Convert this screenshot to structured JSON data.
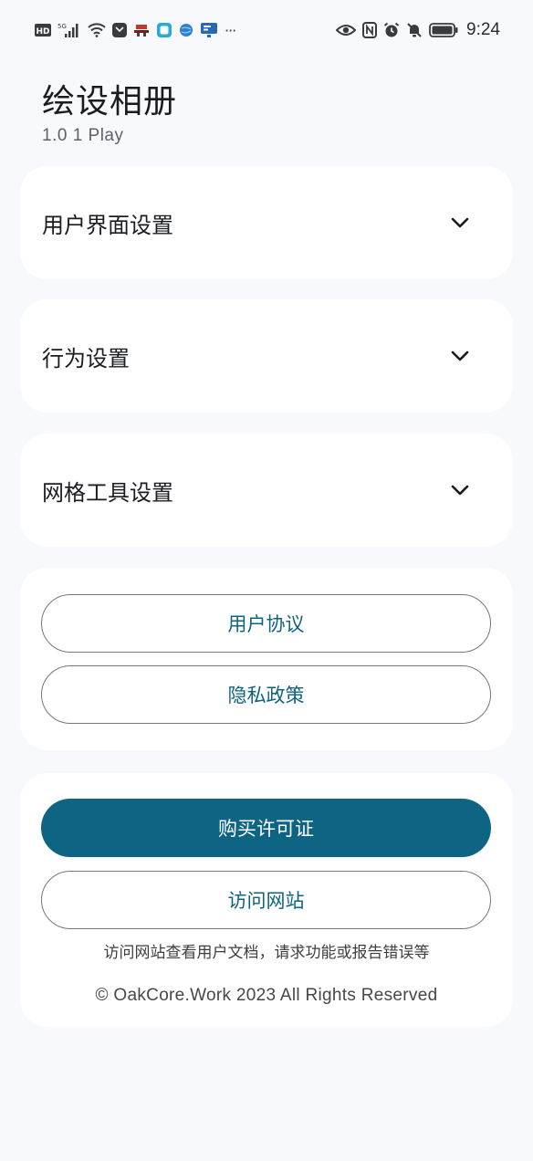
{
  "status_bar": {
    "left_icons": [
      "hd-icon",
      "signal-5g-icon",
      "wifi-icon",
      "app-shield-icon",
      "app-red-icon",
      "app-square-icon",
      "app-globe-icon",
      "app-monitor-icon"
    ],
    "more": "···",
    "right_icons": [
      "eye-icon",
      "nfc-icon",
      "alarm-icon",
      "mute-icon",
      "battery-icon"
    ],
    "time": "9:24"
  },
  "header": {
    "title": "绘设相册",
    "version": "1.0 1 Play"
  },
  "sections": [
    {
      "title": "用户界面设置"
    },
    {
      "title": "行为设置"
    },
    {
      "title": "网格工具设置"
    }
  ],
  "legal": {
    "user_agreement": "用户协议",
    "privacy_policy": "隐私政策"
  },
  "purchase": {
    "buy_license": "购买许可证",
    "visit_site": "访问网站",
    "hint": "访问网站查看用户文档，请求功能或报告错误等",
    "copyright": "© OakCore.Work 2023 All Rights Reserved"
  },
  "colors": {
    "primary": "#0e6583",
    "primary_text": "#0e6480",
    "background": "#f8f9fc",
    "card": "#ffffff",
    "outline": "#72787e"
  }
}
